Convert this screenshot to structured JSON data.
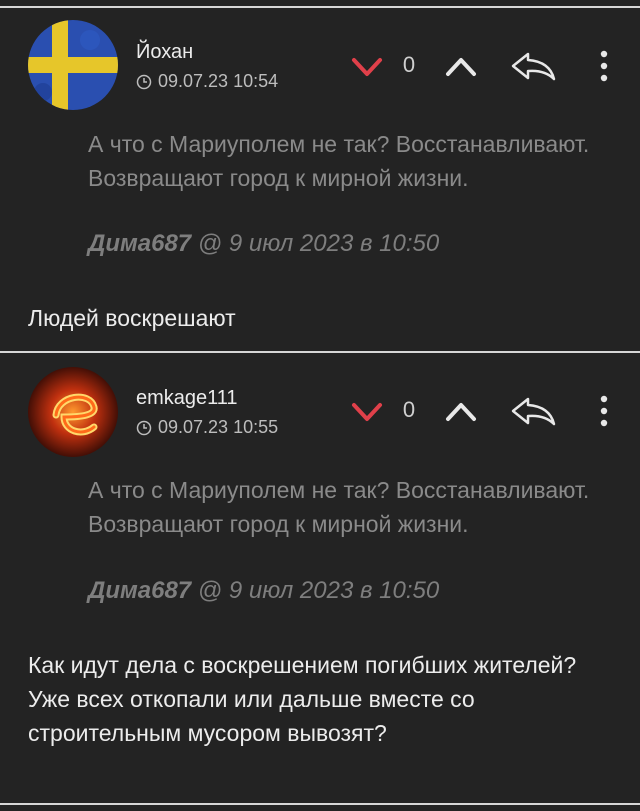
{
  "comments": [
    {
      "username": "Йохан",
      "timestamp": "09.07.23 10:54",
      "score": "0",
      "avatar_icon": "sweden-flag-avatar",
      "quote": "А что с Мариуполем не так? Восстанавливают. Возвращают город к мирной жизни.",
      "quote_author": "Дима687",
      "quote_when": " @ 9 июл 2023 в 10:50",
      "body": "Людей воскрешают"
    },
    {
      "username": "emkage111",
      "timestamp": "09.07.23 10:55",
      "score": "0",
      "avatar_icon": "fire-letter-e-avatar",
      "quote": "А что с Мариуполем не так? Восстанавливают. Возвращают город к мирной жизни.",
      "quote_author": "Дима687",
      "quote_when": " @ 9 июл 2023 в 10:50",
      "body": "Как идут дела с воскрешением погибших жителей?\nУже всех откопали или дальше вместе со строительным мусором вывозят?"
    }
  ],
  "colors": {
    "background": "#232323",
    "downvote": "#e0404a",
    "icon": "#e8e8e8",
    "divider": "#d6d6d6"
  },
  "icons": [
    "clock-icon",
    "downvote-icon",
    "upvote-icon",
    "reply-icon",
    "more-icon"
  ]
}
